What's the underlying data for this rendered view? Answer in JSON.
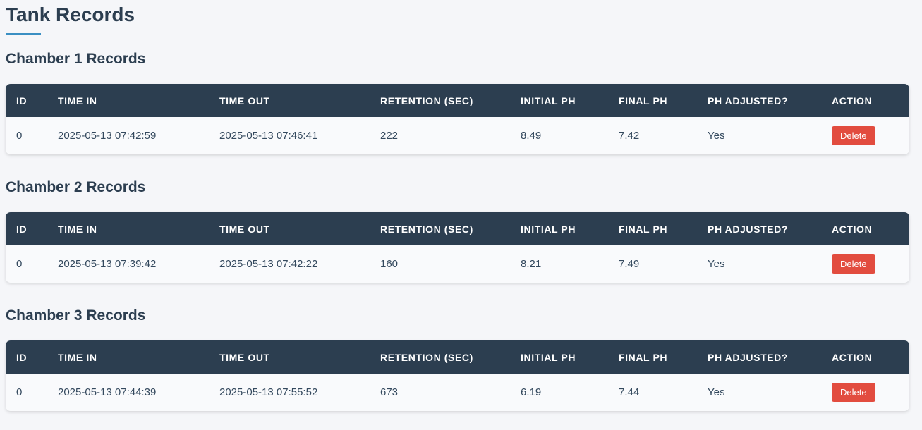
{
  "page": {
    "title": "Tank Records"
  },
  "columns": [
    "ID",
    "Time In",
    "Time Out",
    "Retention (sec)",
    "Initial pH",
    "Final pH",
    "pH Adjusted?",
    "Action"
  ],
  "delete_label": "Delete",
  "colors": {
    "header_bg": "#2c3e50",
    "accent": "#3a8fc3",
    "delete_button": "#e24c3f",
    "page_bg": "#f5f6f9"
  },
  "chambers": [
    {
      "title": "Chamber 1 Records",
      "rows": [
        {
          "id": "0",
          "time_in": "2025-05-13 07:42:59",
          "time_out": "2025-05-13 07:46:41",
          "retention": "222",
          "initial_ph": "8.49",
          "final_ph": "7.42",
          "ph_adjusted": "Yes"
        }
      ]
    },
    {
      "title": "Chamber 2 Records",
      "rows": [
        {
          "id": "0",
          "time_in": "2025-05-13 07:39:42",
          "time_out": "2025-05-13 07:42:22",
          "retention": "160",
          "initial_ph": "8.21",
          "final_ph": "7.49",
          "ph_adjusted": "Yes"
        }
      ]
    },
    {
      "title": "Chamber 3 Records",
      "rows": [
        {
          "id": "0",
          "time_in": "2025-05-13 07:44:39",
          "time_out": "2025-05-13 07:55:52",
          "retention": "673",
          "initial_ph": "6.19",
          "final_ph": "7.44",
          "ph_adjusted": "Yes"
        }
      ]
    }
  ]
}
